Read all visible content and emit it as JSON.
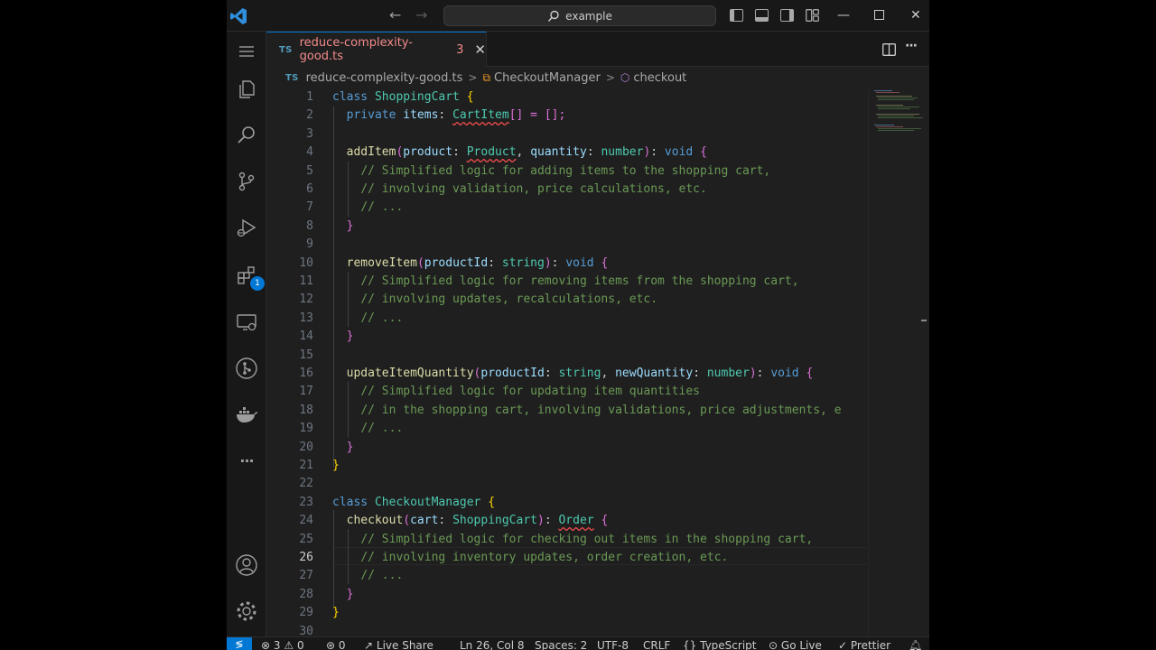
{
  "titlebar": {
    "search_text": "example",
    "back_glyph": "←",
    "forward_glyph": "→",
    "minimize_glyph": "—",
    "close_glyph": "✕"
  },
  "activity": {
    "extensions_badge": "1",
    "more_glyph": "···"
  },
  "tab": {
    "lang": "TS",
    "name": "reduce-complexity-good.ts",
    "problem_count": "3",
    "close_glyph": "✕"
  },
  "editor_actions": {
    "more_glyph": "···"
  },
  "breadcrumb": {
    "lang": "TS",
    "file": "reduce-complexity-good.ts",
    "class": "CheckoutManager",
    "method": "checkout"
  },
  "editor": {
    "active_line": 26,
    "lines": [
      "1",
      "2",
      "3",
      "4",
      "5",
      "6",
      "7",
      "8",
      "9",
      "10",
      "11",
      "12",
      "13",
      "14",
      "15",
      "16",
      "17",
      "18",
      "19",
      "20",
      "21",
      "22",
      "23",
      "24",
      "25",
      "26",
      "27",
      "28",
      "29",
      "30"
    ],
    "code": {
      "l1": [
        "class",
        "ShoppingCart",
        "{"
      ],
      "l2": [
        "private",
        "items",
        ":",
        "CartItem",
        "[] = [];"
      ],
      "l4": [
        "addItem",
        "(",
        "product",
        ":",
        "Product",
        ",",
        "quantity",
        ":",
        "number",
        ")",
        ":",
        "void",
        "{"
      ],
      "l5": "// Simplified logic for adding items to the shopping cart,",
      "l6": "// involving validation, price calculations, etc.",
      "l7": "// ...",
      "l8": "}",
      "l10": [
        "removeItem",
        "(",
        "productId",
        ":",
        "string",
        ")",
        ":",
        "void",
        "{"
      ],
      "l11": "// Simplified logic for removing items from the shopping cart,",
      "l12": "// involving updates, recalculations, etc.",
      "l13": "// ...",
      "l14": "}",
      "l16": [
        "updateItemQuantity",
        "(",
        "productId",
        ":",
        "string",
        ",",
        "newQuantity",
        ":",
        "number",
        ")",
        ":",
        "void",
        "{"
      ],
      "l17": "// Simplified logic for updating item quantities",
      "l18": "// in the shopping cart, involving validations, price adjustments, e",
      "l19": "// ...",
      "l20": "}",
      "l21": "}",
      "l23": [
        "class",
        "CheckoutManager",
        "{"
      ],
      "l24": [
        "checkout",
        "(",
        "cart",
        ":",
        "ShoppingCart",
        ")",
        ":",
        "Order",
        "{"
      ],
      "l25": "// Simplified logic for checking out items in the shopping cart,",
      "l26": "// involving inventory updates, order creation, etc.",
      "l27": "// ...",
      "l28": "}",
      "l29": "}"
    }
  },
  "statusbar": {
    "remote_glyph": "≶",
    "errors": "3",
    "warnings": "0",
    "ports": "0",
    "live_share": "Live Share",
    "position": "Ln 26, Col 8",
    "spaces": "Spaces: 2",
    "encoding": "UTF-8",
    "eol": "CRLF",
    "lang_braces": "{}",
    "language": "TypeScript",
    "go_live": "Go Live",
    "prettier": "Prettier",
    "check_glyph": "✓"
  },
  "colors": {
    "accent": "#0078d4",
    "keyword": "#569cd6",
    "type": "#4ec9b0",
    "function": "#dcdcaa",
    "param": "#9cdcfe",
    "comment": "#6a9955",
    "error": "#f14c4c"
  }
}
